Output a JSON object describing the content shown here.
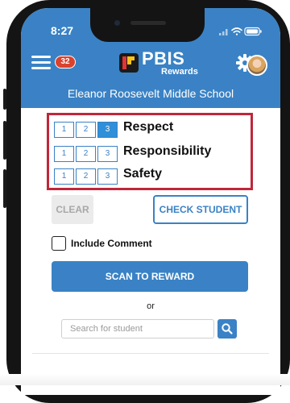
{
  "status_bar": {
    "time": "8:27"
  },
  "header": {
    "notification_count": "32",
    "logo_title": "PBIS",
    "logo_subtitle": "Rewards",
    "school_name": "Eleanor Roosevelt Middle School"
  },
  "ratings": {
    "segment_labels": [
      "1",
      "2",
      "3"
    ],
    "categories": [
      {
        "label": "Respect",
        "selected": "3"
      },
      {
        "label": "Responsibility",
        "selected": ""
      },
      {
        "label": "Safety",
        "selected": ""
      }
    ]
  },
  "actions": {
    "clear_label": "CLEAR",
    "check_student_label": "CHECK STUDENT",
    "include_comment_label": "Include Comment",
    "scan_label": "SCAN TO REWARD",
    "or_label": "or"
  },
  "search": {
    "placeholder": "Search for student",
    "value": ""
  },
  "colors": {
    "primary": "#3a82c5",
    "badge": "#d9432e",
    "highlight_border": "#c0263a",
    "active_segment": "#2f8fd8"
  },
  "icons": [
    "menu-icon",
    "gear-icon",
    "search-icon",
    "wifi-icon",
    "battery-icon",
    "signal-icon"
  ]
}
